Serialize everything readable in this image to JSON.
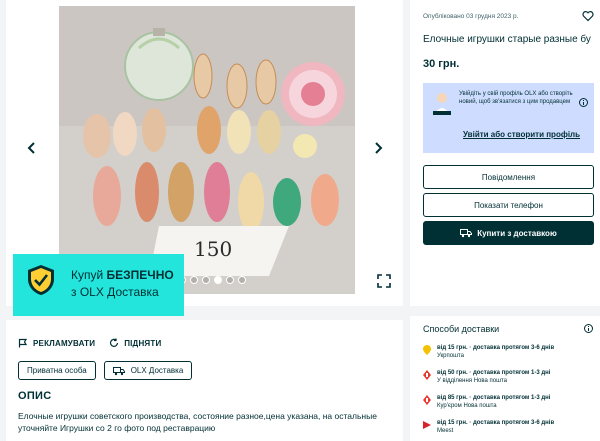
{
  "gallery": {
    "image_alt": "Елочные игрушки",
    "handwritten_price": "150",
    "dots": [
      false,
      false,
      false,
      false,
      true,
      false,
      false
    ],
    "prev_icon": "chevron-left-icon",
    "next_icon": "chevron-right-icon",
    "expand_icon": "expand-icon"
  },
  "description": {
    "report_label": "РЕКЛАМУВАТИ",
    "bump_label": "ПІДНЯТИ",
    "tags": [
      "Приватна особа",
      "OLX Доставка"
    ],
    "title": "ОПИС",
    "text": "Елочные игрушки советского производства, состояние разное,цена указана, на остальные уточняйте Игрушки со 2 го фото под реставрацию"
  },
  "listing": {
    "published": "Опубліковано 03 грудня 2023 р.",
    "title": "Елочные игрушки старые разные бу",
    "price": "30 грн."
  },
  "promo": {
    "text": "Увійдіть у свій профіль OLX або створіть новий, щоб зв'язатися з цим продавцем",
    "link": "Увійти або створити профіль"
  },
  "buttons": {
    "messages": "Повідомлення",
    "phone": "Показати телефон",
    "buy": "Купити з доставкою"
  },
  "banner": {
    "line1_prefix": "Купуй ",
    "line1_bold": "БЕЗПЕЧНО",
    "line2": "з OLX Доставка"
  },
  "delivery": {
    "title": "Способи доставки",
    "items": [
      {
        "price": "від 15 грн. · доставка протягом 3-6 днів",
        "carrier": "Укрпошта",
        "icon": "ukrposhta-icon",
        "color": "#f4c200"
      },
      {
        "price": "від 50 грн. · доставка протягом 1-3 дні",
        "carrier": "У відділення Нова пошта",
        "icon": "nova-poshta-icon",
        "color": "#e8392f"
      },
      {
        "price": "від 85 грн. · доставка протягом 1-3 дні",
        "carrier": "Кур'єром Нова пошта",
        "icon": "nova-poshta-icon",
        "color": "#e8392f"
      },
      {
        "price": "від 15 грн. · доставка протягом 3-6 днів",
        "carrier": "Meest",
        "icon": "meest-icon",
        "color": "#d8232a"
      }
    ]
  },
  "colors": {
    "brand_dark": "#002f34",
    "promo_bg": "#ceddff",
    "banner_bg": "#23e5db",
    "page_bg": "#f2f4f5"
  }
}
